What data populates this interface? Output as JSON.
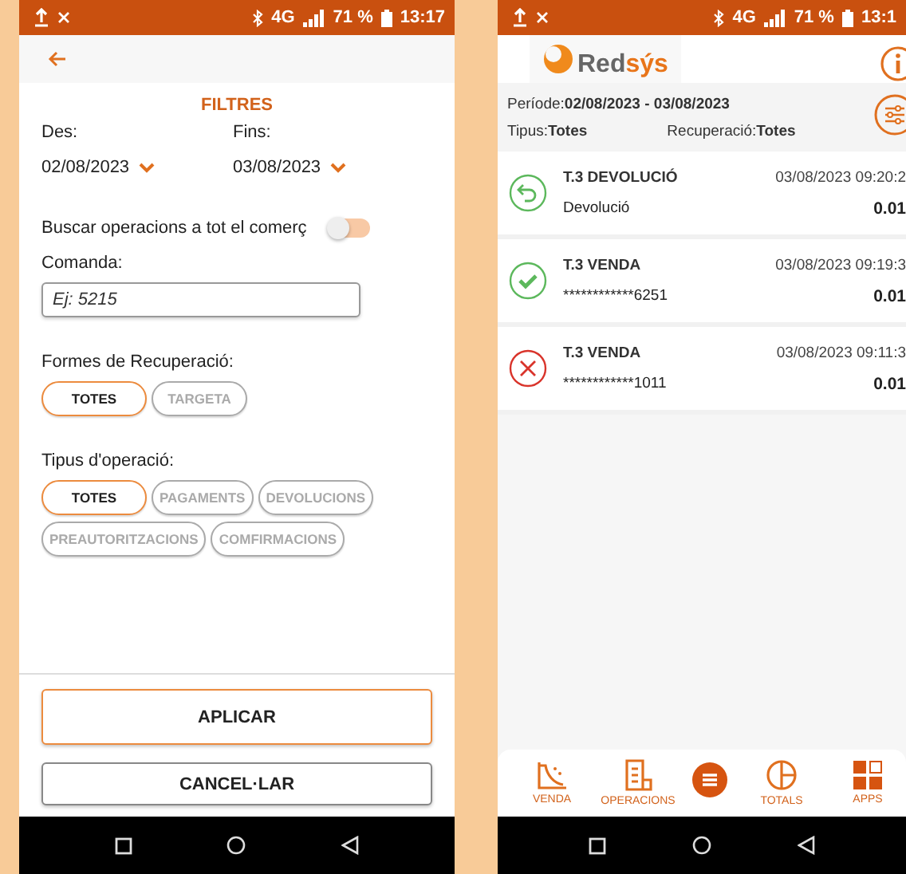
{
  "filters_screen": {
    "status_bar": {
      "network": "4G",
      "battery": "71 %",
      "time": "13:17"
    },
    "title": "FILTRES",
    "date_from": {
      "label": "Des:",
      "value": "02/08/2023"
    },
    "date_to": {
      "label": "Fins:",
      "value": "03/08/2023"
    },
    "search_all": {
      "label": "Buscar operacions a tot el comerç",
      "on": false
    },
    "order": {
      "label": "Comanda:",
      "placeholder": "Ej: 5215"
    },
    "recovery": {
      "label": "Formes de Recuperació:",
      "options": [
        {
          "label": "TOTES",
          "selected": true
        },
        {
          "label": "TARGETA",
          "selected": false
        }
      ]
    },
    "operation_type": {
      "label": "Tipus d'operació:",
      "options": [
        {
          "label": "TOTES",
          "selected": true
        },
        {
          "label": "PAGAMENTS",
          "selected": false
        },
        {
          "label": "DEVOLUCIONS",
          "selected": false
        },
        {
          "label": "PREAUTORITZACIONS",
          "selected": false
        },
        {
          "label": "COMFIRMACIONS",
          "selected": false
        }
      ]
    },
    "buttons": [
      {
        "label": "APLICAR",
        "kind": "primary"
      },
      {
        "label": "CANCEL·LAR",
        "kind": "secondary"
      }
    ]
  },
  "operations_screen": {
    "status_bar": {
      "network": "4G",
      "battery": "71 %",
      "time": "13:1"
    },
    "logo": {
      "part_1": "Red",
      "part_2": "sýs"
    },
    "summary": {
      "period_label": "Període:",
      "period": "02/08/2023 - 03/08/2023",
      "type_label": "Tipus:",
      "type": "Totes",
      "recovery_label": "Recuperació:",
      "recovery": "Totes"
    },
    "operations": [
      {
        "kind": "refund",
        "title": "T.3 DEVOLUCIÓ",
        "detail": "Devolució",
        "datetime": "03/08/2023 09:20:2",
        "amount": "0.01"
      },
      {
        "kind": "approved",
        "title": "T.3 VENDA",
        "detail": "************6251",
        "datetime": "03/08/2023 09:19:3",
        "amount": "0.01"
      },
      {
        "kind": "declined",
        "title": "T.3 VENDA",
        "detail": "************1011",
        "datetime": "03/08/2023 09:11:3",
        "amount": "0.01"
      }
    ],
    "bottom_nav": [
      {
        "kind": "sale",
        "label": "VENDA"
      },
      {
        "kind": "operations",
        "label": "OPERACIONS"
      },
      {
        "kind": "menu"
      },
      {
        "kind": "totals",
        "label": "TOTALS"
      },
      {
        "kind": "apps",
        "label": "APPS"
      }
    ]
  }
}
